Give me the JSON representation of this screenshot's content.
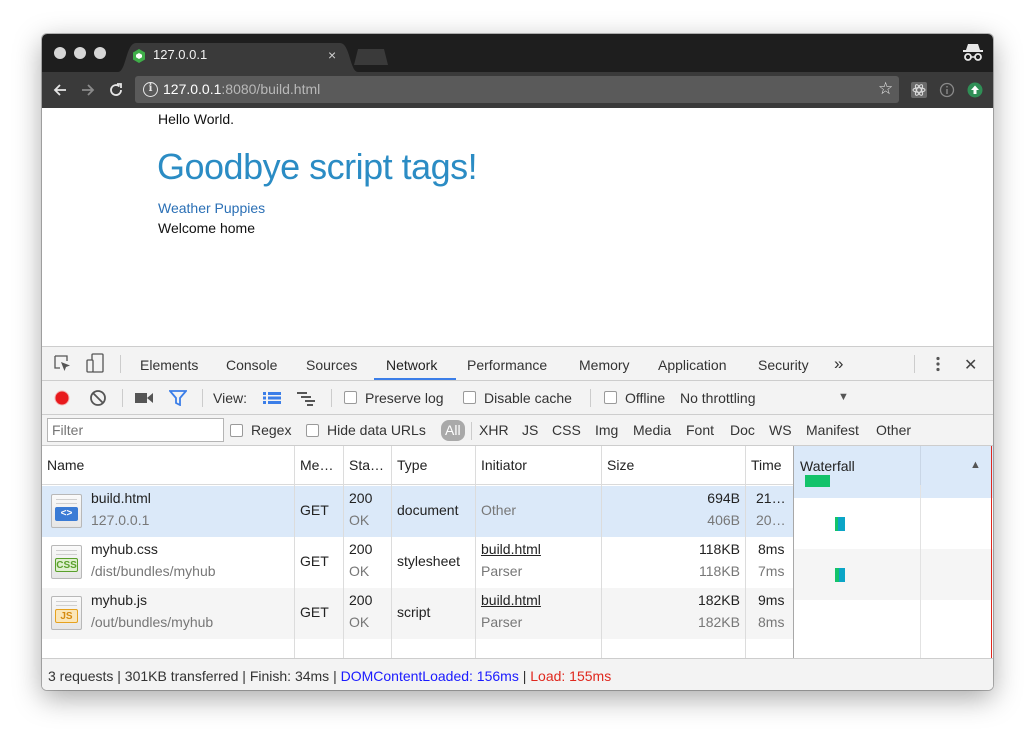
{
  "browser": {
    "tab_title": "127.0.0.1",
    "tab_close": "×",
    "url_host": "127.0.0.1",
    "url_rest": ":8080/build.html"
  },
  "page": {
    "hello": "Hello World.",
    "heading": "Goodbye script tags!",
    "link": "Weather Puppies",
    "welcome": "Welcome home"
  },
  "devtools": {
    "tabs": [
      "Elements",
      "Console",
      "Sources",
      "Network",
      "Performance",
      "Memory",
      "Application",
      "Security"
    ],
    "more": "»",
    "close": "✕",
    "toolbar": {
      "view_label": "View:",
      "preserve_log": "Preserve log",
      "disable_cache": "Disable cache",
      "offline": "Offline",
      "throttling": "No throttling",
      "dropdown_arrow": "▼"
    },
    "filter": {
      "placeholder": "Filter",
      "regex": "Regex",
      "hide_data_urls": "Hide data URLs",
      "types": [
        "All",
        "XHR",
        "JS",
        "CSS",
        "Img",
        "Media",
        "Font",
        "Doc",
        "WS",
        "Manifest",
        "Other"
      ]
    },
    "columns": {
      "name": "Name",
      "method": "Me…",
      "status": "Sta…",
      "type": "Type",
      "initiator": "Initiator",
      "size": "Size",
      "time": "Time",
      "waterfall": "Waterfall",
      "sort_arrow": "▲"
    },
    "rows": [
      {
        "name": "build.html",
        "path": "127.0.0.1",
        "method": "GET",
        "status": "200",
        "status_text": "OK",
        "type": "document",
        "initiator": "Other",
        "initiator_sub": "",
        "size": "694B",
        "size_sub": "406B",
        "time": "21…",
        "time_sub": "20…",
        "badge": "<>",
        "badge_color": "#3a7bd5"
      },
      {
        "name": "myhub.css",
        "path": "/dist/bundles/myhub",
        "method": "GET",
        "status": "200",
        "status_text": "OK",
        "type": "stylesheet",
        "initiator": "build.html",
        "initiator_sub": "Parser",
        "size": "118KB",
        "size_sub": "118KB",
        "time": "8ms",
        "time_sub": "7ms",
        "badge": "CSS",
        "badge_color": "#5aa02c"
      },
      {
        "name": "myhub.js",
        "path": "/out/bundles/myhub",
        "method": "GET",
        "status": "200",
        "status_text": "OK",
        "type": "script",
        "initiator": "build.html",
        "initiator_sub": "Parser",
        "size": "182KB",
        "size_sub": "182KB",
        "time": "9ms",
        "time_sub": "8ms",
        "badge": "JS",
        "badge_color": "#e6a21f"
      }
    ],
    "status_bar": {
      "summary": "3 requests | 301KB transferred | Finish: 34ms | ",
      "dom_loaded": "DOMContentLoaded: 156ms",
      "pipe": " | ",
      "load": "Load: 155ms"
    },
    "colors": {
      "accent": "#3b7ee8",
      "record": "#e8191c",
      "dom_loaded": "#1a1aff",
      "load": "#e0281e",
      "selected_row": "#dbe9f9"
    }
  }
}
